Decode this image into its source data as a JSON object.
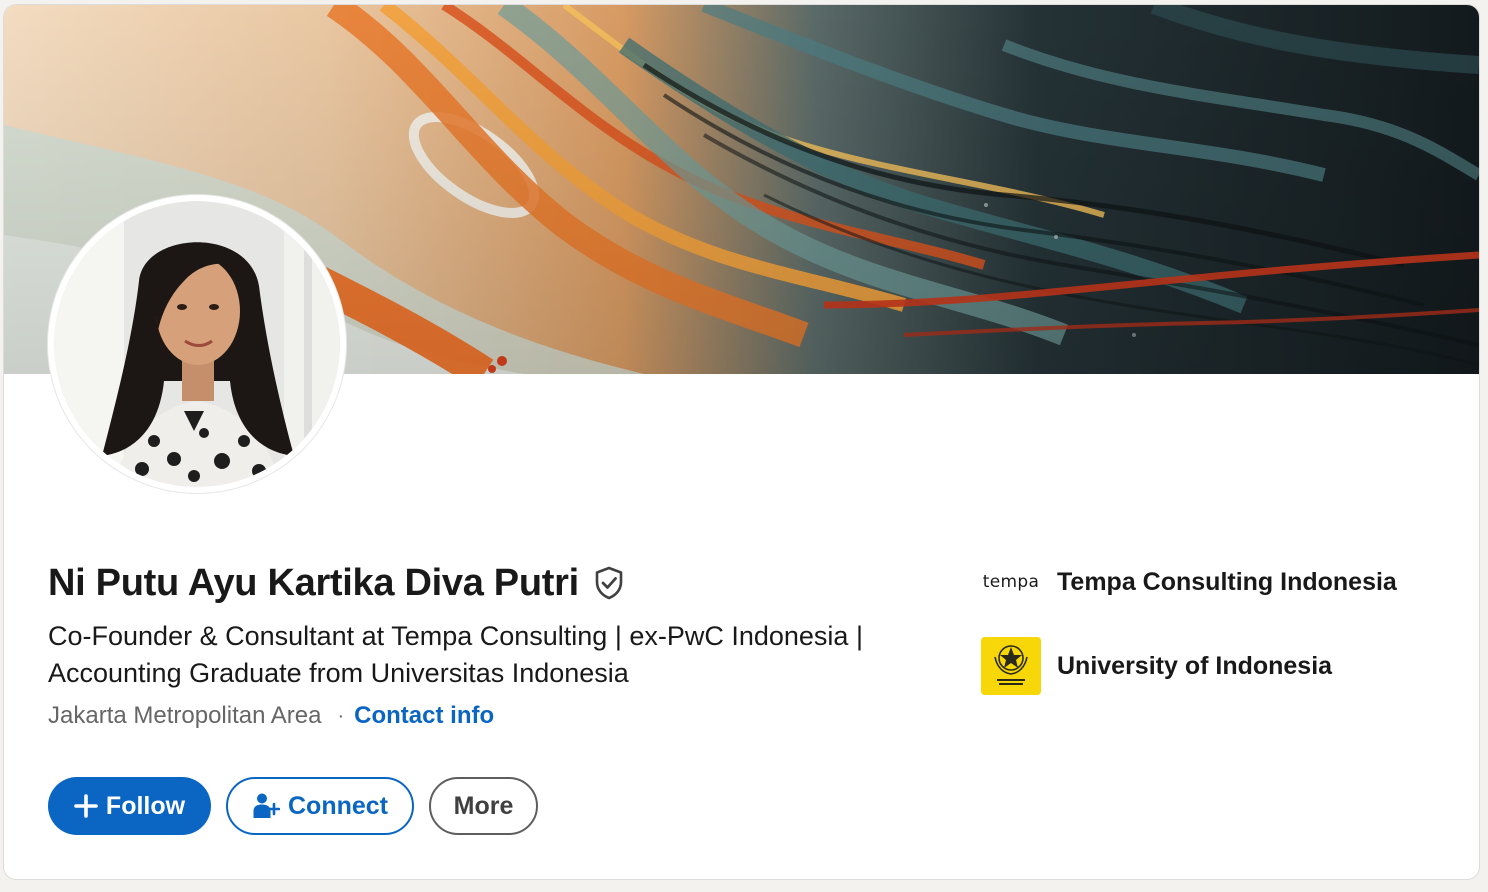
{
  "profile": {
    "name": "Ni Putu Ayu Kartika Diva Putri",
    "headline": "Co-Founder & Consultant at Tempa Consulting | ex-PwC Indonesia | Accounting Graduate from Universitas Indonesia",
    "location": "Jakarta Metropolitan Area",
    "separator": "·",
    "contact_label": "Contact info"
  },
  "actions": {
    "follow_label": "Follow",
    "connect_label": "Connect",
    "more_label": "More"
  },
  "organizations": [
    {
      "logo_text": "tempa",
      "name": "Tempa Consulting Indonesia"
    },
    {
      "name": "University of Indonesia"
    }
  ],
  "icons": {
    "verified": "verified-shield-icon",
    "follow": "plus-icon",
    "connect": "person-add-icon"
  },
  "colors": {
    "accent": "#0a66c2",
    "text_primary": "#191919",
    "text_secondary": "#666666",
    "ui_yellow": "#f7d708"
  }
}
